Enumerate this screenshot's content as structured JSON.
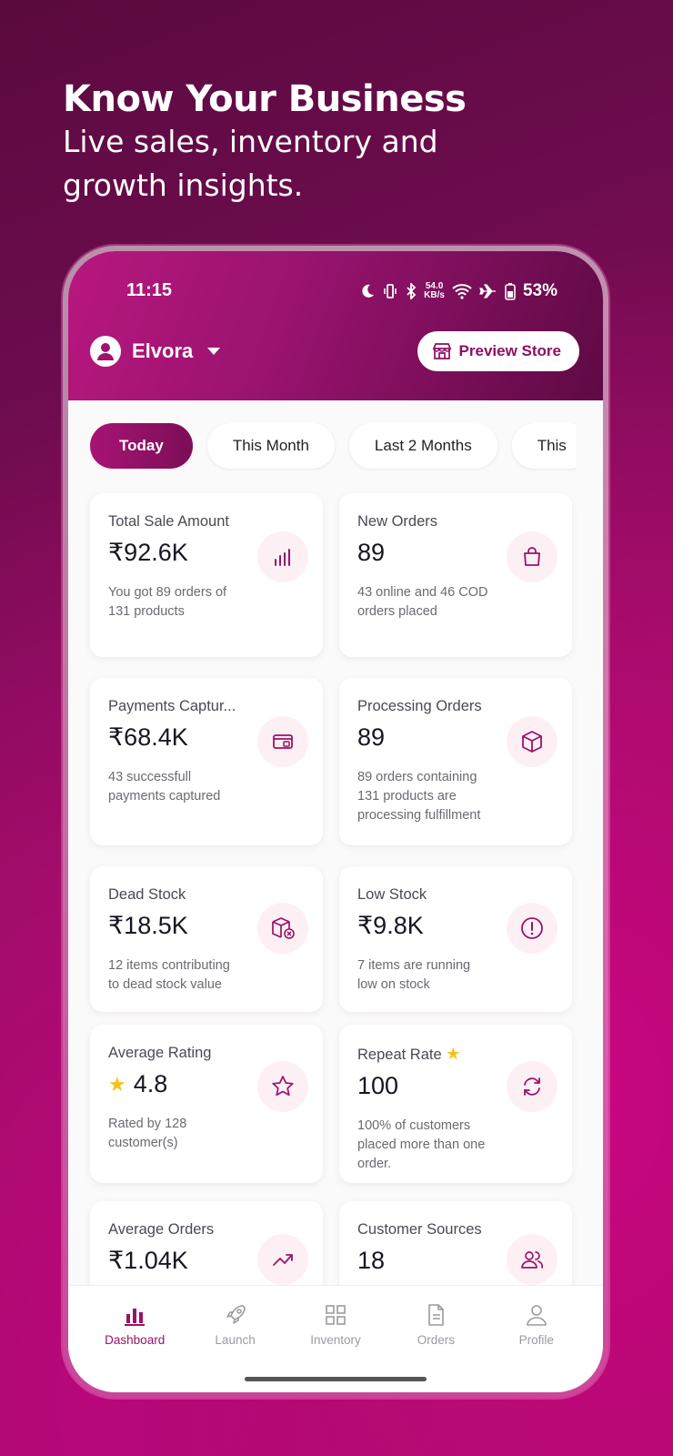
{
  "promo": {
    "title": "Know Your Business",
    "subtitle_line1": "Live sales, inventory and",
    "subtitle_line2": "growth insights."
  },
  "status_bar": {
    "time": "11:15",
    "net_speed_value": "54.0",
    "net_speed_unit": "KB/s",
    "battery": "53%"
  },
  "header": {
    "store_name": "Elvora",
    "preview_button": "Preview Store"
  },
  "filters": [
    {
      "label": "Today",
      "active": true
    },
    {
      "label": "This Month",
      "active": false
    },
    {
      "label": "Last 2 Months",
      "active": false
    },
    {
      "label": "This",
      "active": false
    }
  ],
  "cards": {
    "total_sale": {
      "title": "Total Sale Amount",
      "value": "₹92.6K",
      "desc1": "You got 89 orders of",
      "desc2": "131 products",
      "icon": "bar-chart-icon"
    },
    "new_orders": {
      "title": "New Orders",
      "value": "89",
      "desc1": "43 online and 46 COD",
      "desc2": "orders placed",
      "icon": "shopping-bag-icon"
    },
    "payments": {
      "title": "Payments Captur...",
      "value": "₹68.4K",
      "desc1": "43 successfull",
      "desc2": "payments captured",
      "icon": "card-icon"
    },
    "processing": {
      "title": "Processing Orders",
      "value": "89",
      "desc1": "89 orders containing",
      "desc2": "131 products are",
      "desc3": "processing fulfillment",
      "icon": "box-icon"
    },
    "dead_stock": {
      "title": "Dead Stock",
      "value": "₹18.5K",
      "desc1": "12 items contributing",
      "desc2": "to dead stock value",
      "icon": "box-cancel-icon"
    },
    "low_stock": {
      "title": "Low Stock",
      "value": "₹9.8K",
      "desc1": "7 items are running",
      "desc2": "low on stock",
      "icon": "alert-icon"
    },
    "avg_rating": {
      "title": "Average Rating",
      "value": "4.8",
      "desc1": "Rated by 128",
      "desc2": "customer(s)",
      "icon": "star-icon"
    },
    "repeat_rate": {
      "title": "Repeat Rate",
      "value": "100",
      "desc1": "100% of customers",
      "desc2": "placed more than one",
      "desc3": "order.",
      "icon": "refresh-icon"
    },
    "avg_orders": {
      "title": "Average Orders",
      "value": "₹1.04K",
      "icon": "trend-up-icon"
    },
    "customer_sources": {
      "title": "Customer Sources",
      "value": "18",
      "icon": "users-icon"
    }
  },
  "bottom_nav": [
    {
      "label": "Dashboard",
      "active": true
    },
    {
      "label": "Launch",
      "active": false
    },
    {
      "label": "Inventory",
      "active": false
    },
    {
      "label": "Orders",
      "active": false
    },
    {
      "label": "Profile",
      "active": false
    }
  ],
  "colors": {
    "brand": "#9a1268",
    "icon_bg": "#fdf0f5",
    "star": "#f2c31a"
  }
}
